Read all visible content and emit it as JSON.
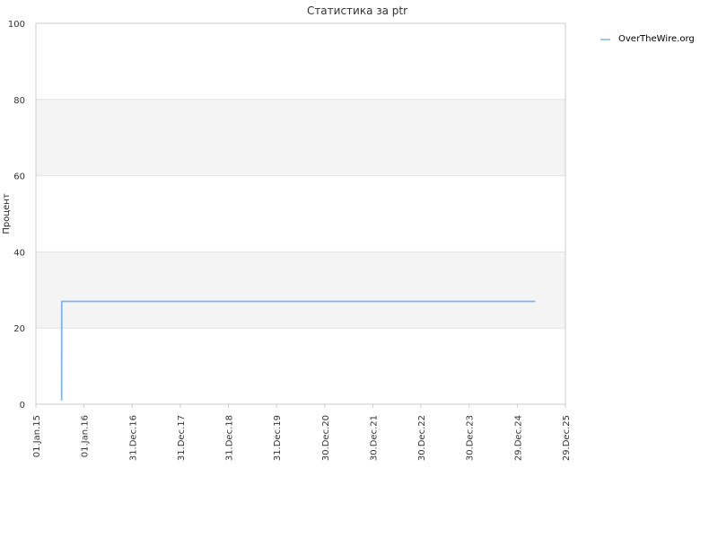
{
  "chart_data": {
    "type": "line",
    "title": "Статистика за ptr",
    "xlabel": "",
    "ylabel": "Процент",
    "ylim": [
      0,
      100
    ],
    "yticks": [
      0,
      20,
      40,
      60,
      80,
      100
    ],
    "xlim": [
      "2015-01-01",
      "2025-12-29"
    ],
    "xticks": [
      {
        "date": "2015-01-01",
        "label": "01.Jan.15"
      },
      {
        "date": "2016-01-01",
        "label": "01.Jan.16"
      },
      {
        "date": "2016-12-31",
        "label": "31.Dec.16"
      },
      {
        "date": "2017-12-31",
        "label": "31.Dec.17"
      },
      {
        "date": "2018-12-31",
        "label": "31.Dec.18"
      },
      {
        "date": "2019-12-31",
        "label": "31.Dec.19"
      },
      {
        "date": "2020-12-30",
        "label": "30.Dec.20"
      },
      {
        "date": "2021-12-30",
        "label": "30.Dec.21"
      },
      {
        "date": "2022-12-30",
        "label": "30.Dec.22"
      },
      {
        "date": "2023-12-30",
        "label": "30.Dec.23"
      },
      {
        "date": "2024-12-29",
        "label": "29.Dec.24"
      },
      {
        "date": "2025-12-29",
        "label": "29.Dec.25"
      }
    ],
    "grid": true,
    "alternate_bands": true,
    "legend_position": "top-right",
    "series": [
      {
        "name": "OverTheWire.org",
        "color": "#7cb5ec",
        "points": [
          {
            "x": "2015-07-15",
            "y": 1
          },
          {
            "x": "2015-07-16",
            "y": 27
          },
          {
            "x": "2025-05-15",
            "y": 27
          }
        ]
      }
    ]
  }
}
